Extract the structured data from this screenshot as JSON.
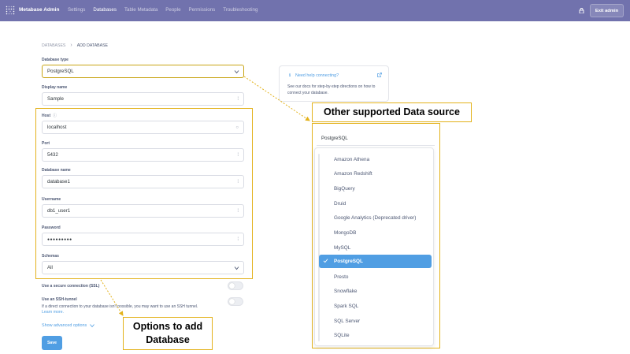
{
  "topnav": {
    "brand": "Metabase Admin",
    "links": [
      "Settings",
      "Databases",
      "Table Metadata",
      "People",
      "Permissions",
      "Troubleshooting"
    ],
    "active_link": "Databases",
    "exit_label": "Exit admin",
    "bg_color": "#7172ad"
  },
  "breadcrumb": {
    "parent": "DATABASES",
    "current": "ADD DATABASE"
  },
  "form": {
    "database_type_label": "Database type",
    "database_type_value": "PostgreSQL",
    "display_name_label": "Display name",
    "display_name_value": "Sample",
    "host_label": "Host",
    "host_value": "localhost",
    "port_label": "Port",
    "port_value": "5432",
    "database_name_label": "Database name",
    "database_name_value": "database1",
    "username_label": "Username",
    "username_value": "db1_user1",
    "password_label": "Password",
    "password_value": "●●●●●●●●●",
    "schemas_label": "Schemas",
    "schemas_value": "All",
    "ssl_label": "Use a secure connection (SSL)",
    "ssh_label": "Use an SSH-tunnel",
    "ssh_desc": "If a direct connection to your database isn't possible, you may want to use an SSH tunnel.",
    "learn_more": "Learn more.",
    "advanced_options": "Show advanced options",
    "save_label": "Save"
  },
  "help_card": {
    "title": "Need help connecting?",
    "body": "See our docs for step-by-step directions on how to connect your database."
  },
  "annotations": {
    "datasource_callout": "Other supported Data source",
    "options_callout_line1": "Options to add",
    "options_callout_line2": "Database",
    "highlight_color": "#e3b21b"
  },
  "dropdown": {
    "current": "PostgreSQL",
    "items": [
      "Amazon Athena",
      "Amazon Redshift",
      "BigQuery",
      "Druid",
      "Google Analytics (Deprecated driver)",
      "MongoDB",
      "MySQL",
      "PostgreSQL",
      "Presto",
      "Snowflake",
      "Spark SQL",
      "SQL Server",
      "SQLite"
    ],
    "selected": "PostgreSQL",
    "accent": "#509ee3"
  }
}
